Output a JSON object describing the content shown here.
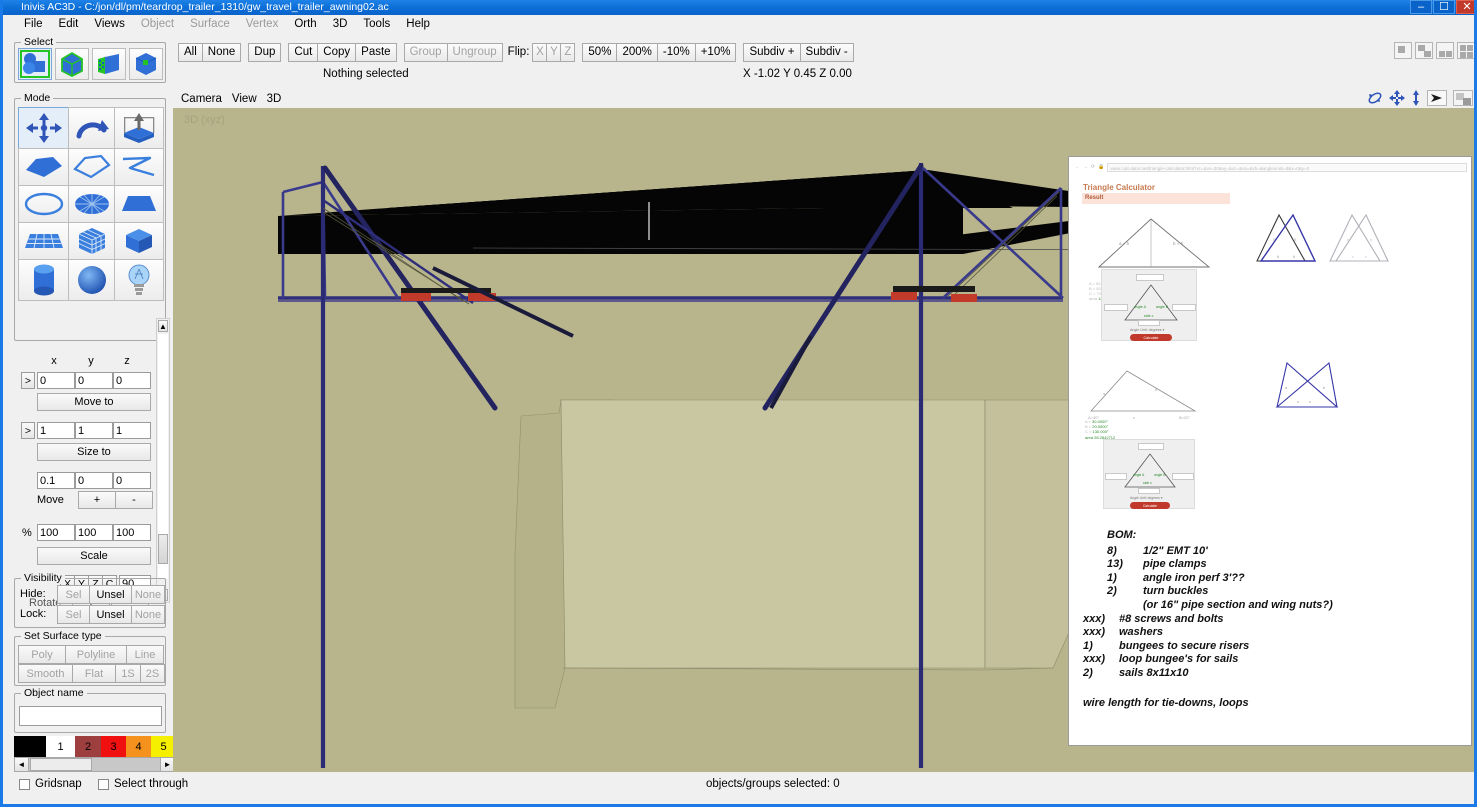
{
  "window": {
    "title": "Inivis AC3D - C:/jon/dl/pm/teardrop_trailer_1310/gw_travel_trailer_awning02.ac",
    "app_icon": "ac3d-logo-icon",
    "minimize": "–",
    "maximize": "☐",
    "close": "✕"
  },
  "menu": [
    {
      "label": "File",
      "enabled": true
    },
    {
      "label": "Edit",
      "enabled": true
    },
    {
      "label": "Views",
      "enabled": true
    },
    {
      "label": "Object",
      "enabled": false
    },
    {
      "label": "Surface",
      "enabled": false
    },
    {
      "label": "Vertex",
      "enabled": false
    },
    {
      "label": "Orth",
      "enabled": true
    },
    {
      "label": "3D",
      "enabled": true
    },
    {
      "label": "Tools",
      "enabled": true
    },
    {
      "label": "Help",
      "enabled": true
    }
  ],
  "toolbar": {
    "buttons": [
      {
        "label": "All",
        "enabled": true
      },
      {
        "label": "None",
        "enabled": true
      },
      {
        "label": "Dup",
        "enabled": true
      },
      {
        "label": "Cut",
        "enabled": true
      },
      {
        "label": "Copy",
        "enabled": true
      },
      {
        "label": "Paste",
        "enabled": true
      },
      {
        "label": "Group",
        "enabled": false
      },
      {
        "label": "Ungroup",
        "enabled": false
      }
    ],
    "flip_label": "Flip:",
    "flip_axes": [
      "X",
      "Y",
      "Z"
    ],
    "zoom_buttons": [
      {
        "label": "50%"
      },
      {
        "label": "200%"
      },
      {
        "label": "-10%"
      },
      {
        "label": "+10%"
      }
    ],
    "subdiv_buttons": [
      {
        "label": "Subdiv +"
      },
      {
        "label": "Subdiv -"
      }
    ],
    "layout_buttons": [
      "layout-single-icon",
      "layout-two-icon",
      "layout-three-icon",
      "layout-four-icon"
    ]
  },
  "status": {
    "selection_text": "Nothing selected",
    "coordinates": "X -1.02 Y 0.45 Z 0.00",
    "objects_selected": "objects/groups selected: 0"
  },
  "select_panel": {
    "title": "Select",
    "items": [
      {
        "name": "select-group-icon",
        "selected": true
      },
      {
        "name": "select-object-icon",
        "selected": false
      },
      {
        "name": "select-surface-icon",
        "selected": false
      },
      {
        "name": "select-vertex-icon",
        "selected": false
      }
    ]
  },
  "mode_panel": {
    "title": "Mode",
    "items": [
      {
        "name": "move-tool-icon",
        "selected": true
      },
      {
        "name": "rotate-tool-icon",
        "selected": false
      },
      {
        "name": "extrude-tool-icon",
        "selected": false
      },
      {
        "name": "polygon-tool-icon",
        "selected": false
      },
      {
        "name": "polyline-tool-icon",
        "selected": false
      },
      {
        "name": "freehand-tool-icon",
        "selected": false
      },
      {
        "name": "circle-tool-icon",
        "selected": false
      },
      {
        "name": "disc-tool-icon",
        "selected": false
      },
      {
        "name": "plane-tool-icon",
        "selected": false
      },
      {
        "name": "grid-tool-icon",
        "selected": false
      },
      {
        "name": "subdivided-cube-icon",
        "selected": false
      },
      {
        "name": "box-tool-icon",
        "selected": false
      },
      {
        "name": "cylinder-tool-icon",
        "selected": false
      },
      {
        "name": "sphere-tool-icon",
        "selected": false
      },
      {
        "name": "light-tool-icon",
        "selected": false
      }
    ]
  },
  "transform_panel": {
    "axis_headers": [
      "x",
      "y",
      "z"
    ],
    "move_to": {
      "values": [
        "0",
        "0",
        "0"
      ],
      "button": "Move to",
      "expander": ">"
    },
    "size_to": {
      "values": [
        "1",
        "1",
        "1"
      ],
      "button": "Size to",
      "expander": ">"
    },
    "move_by": {
      "values": [
        "0.1",
        "0",
        "0"
      ],
      "label": "Move",
      "plus": "+",
      "minus": "-"
    },
    "scale": {
      "symbol": "%",
      "values": [
        "100",
        "100",
        "100"
      ],
      "button": "Scale"
    },
    "rotate": {
      "axes": [
        "X",
        "Y",
        "Z",
        "C"
      ],
      "angle": "90",
      "label": "Rotate",
      "plus": "+",
      "minus": "-"
    }
  },
  "visibility_panel": {
    "title": "Visibility",
    "rows": [
      {
        "label": "Hide:",
        "buttons": [
          {
            "label": "Sel",
            "enabled": false
          },
          {
            "label": "Unsel",
            "enabled": true
          },
          {
            "label": "None",
            "enabled": false
          }
        ]
      },
      {
        "label": "Lock:",
        "buttons": [
          {
            "label": "Sel",
            "enabled": false
          },
          {
            "label": "Unsel",
            "enabled": true
          },
          {
            "label": "None",
            "enabled": false
          }
        ]
      }
    ]
  },
  "surface_panel": {
    "title": "Set Surface type",
    "row1": [
      {
        "label": "Poly",
        "enabled": false
      },
      {
        "label": "Polyline",
        "enabled": false
      },
      {
        "label": "Line",
        "enabled": false
      }
    ],
    "row2": [
      {
        "label": "Smooth",
        "enabled": false
      },
      {
        "label": "Flat",
        "enabled": false
      },
      {
        "label": "1S",
        "enabled": false
      },
      {
        "label": "2S",
        "enabled": false
      }
    ]
  },
  "object_name_panel": {
    "title": "Object name",
    "value": "",
    "placeholder": ""
  },
  "palette": {
    "swatches": [
      {
        "label": "",
        "color": "#000000",
        "text_color": "#ffffff"
      },
      {
        "label": "1",
        "color": "#ffffff",
        "text_color": "#000000"
      },
      {
        "label": "2",
        "color": "#9e3f3f",
        "text_color": "#000000"
      },
      {
        "label": "3",
        "color": "#f01010",
        "text_color": "#000000"
      },
      {
        "label": "4",
        "color": "#f5921e",
        "text_color": "#000000"
      },
      {
        "label": "5",
        "color": "#f5f000",
        "text_color": "#000000"
      },
      {
        "label": "",
        "color": "#11d611",
        "text_color": "#000000"
      }
    ],
    "scroll_left": "◄",
    "scroll_right": "►"
  },
  "viewport": {
    "menu": [
      "Camera",
      "View",
      "3D"
    ],
    "label": "3D (xyz)",
    "background_color": "#b8b58d",
    "icons": [
      "orbit-icon",
      "pan-icon",
      "zoom-vertical-icon",
      "pick-arrow-icon",
      "maximize-view-icon"
    ]
  },
  "bottom": {
    "gridsnap_label": "Gridsnap",
    "gridsnap_checked": false,
    "select_through_label": "Select through",
    "select_through_checked": false
  },
  "reference_image": {
    "browser_url": "www.calculator.net/triangle-calculator.html?vc=&vx=30&vy=&vz=&va=&vb=&angleunits=d&x=0&y=0",
    "page_title": "Triangle Calculator",
    "result_label": "Result",
    "bom_heading": "BOM:",
    "bom_lines": [
      {
        "qty": "8)",
        "item": "1/2\" EMT 10'"
      },
      {
        "qty": "13)",
        "item": "pipe clamps"
      },
      {
        "qty": "1)",
        "item": "angle iron perf 3'??"
      },
      {
        "qty": "2)",
        "item": "turn buckles"
      },
      {
        "qty": "",
        "item": "(or 16\" pipe section and wing nuts?)"
      },
      {
        "qty": "xxx)",
        "item": "#8 screws and bolts"
      },
      {
        "qty": "xxx)",
        "item": "washers"
      },
      {
        "qty": "1)",
        "item": "bungees to secure risers"
      },
      {
        "qty": "xxx)",
        "item": "loop bungee's for sails"
      },
      {
        "qty": "2)",
        "item": "sails 8x11x10"
      }
    ],
    "bom_footer": "wire length for tie-downs, loops",
    "calc_button_label": "Calculate"
  },
  "model": {
    "pole_color": "#2e2e7a",
    "sail_color": "#050505",
    "clamp_color": "#c23b2a",
    "trailer_fill": "#c2bf99"
  }
}
